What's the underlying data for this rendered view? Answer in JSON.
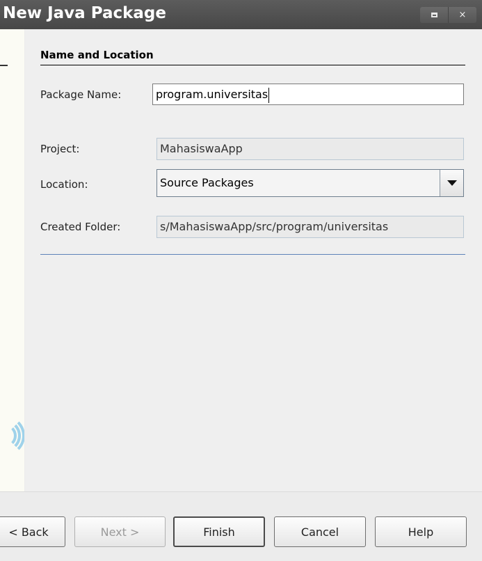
{
  "window": {
    "title": "New Java Package",
    "controls": {
      "maximize_icon": "maximize-icon",
      "close_glyph": "×"
    }
  },
  "section": {
    "title": "Name and Location"
  },
  "form": {
    "package_name": {
      "label": "Package Name:",
      "value": "program.universitas"
    },
    "project": {
      "label": "Project:",
      "value": "MahasiswaApp"
    },
    "location": {
      "label": "Location:",
      "value": "Source Packages"
    },
    "created_folder": {
      "label": "Created Folder:",
      "value": "s/MahasiswaApp/src/program/universitas"
    }
  },
  "buttons": {
    "back": "< Back",
    "next": "Next >",
    "finish": "Finish",
    "cancel": "Cancel",
    "help": "Help"
  },
  "colors": {
    "titlebar": "#4f4f4f",
    "separator": "#5d82b8",
    "left_panel": "#fbfbf4"
  }
}
